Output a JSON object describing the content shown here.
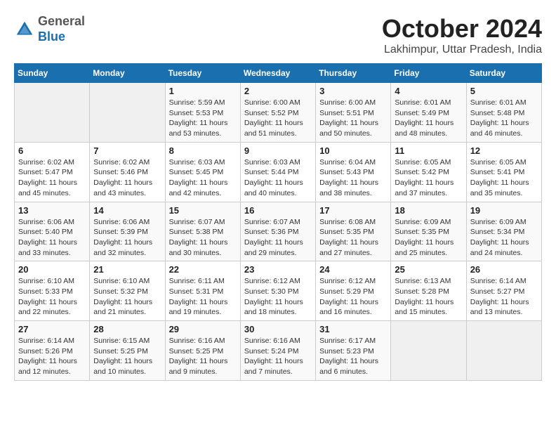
{
  "header": {
    "logo": {
      "line1": "General",
      "line2": "Blue"
    },
    "title": "October 2024",
    "location": "Lakhimpur, Uttar Pradesh, India"
  },
  "days_of_week": [
    "Sunday",
    "Monday",
    "Tuesday",
    "Wednesday",
    "Thursday",
    "Friday",
    "Saturday"
  ],
  "weeks": [
    [
      {
        "day": "",
        "info": ""
      },
      {
        "day": "",
        "info": ""
      },
      {
        "day": "1",
        "info": "Sunrise: 5:59 AM\nSunset: 5:53 PM\nDaylight: 11 hours and 53 minutes."
      },
      {
        "day": "2",
        "info": "Sunrise: 6:00 AM\nSunset: 5:52 PM\nDaylight: 11 hours and 51 minutes."
      },
      {
        "day": "3",
        "info": "Sunrise: 6:00 AM\nSunset: 5:51 PM\nDaylight: 11 hours and 50 minutes."
      },
      {
        "day": "4",
        "info": "Sunrise: 6:01 AM\nSunset: 5:49 PM\nDaylight: 11 hours and 48 minutes."
      },
      {
        "day": "5",
        "info": "Sunrise: 6:01 AM\nSunset: 5:48 PM\nDaylight: 11 hours and 46 minutes."
      }
    ],
    [
      {
        "day": "6",
        "info": "Sunrise: 6:02 AM\nSunset: 5:47 PM\nDaylight: 11 hours and 45 minutes."
      },
      {
        "day": "7",
        "info": "Sunrise: 6:02 AM\nSunset: 5:46 PM\nDaylight: 11 hours and 43 minutes."
      },
      {
        "day": "8",
        "info": "Sunrise: 6:03 AM\nSunset: 5:45 PM\nDaylight: 11 hours and 42 minutes."
      },
      {
        "day": "9",
        "info": "Sunrise: 6:03 AM\nSunset: 5:44 PM\nDaylight: 11 hours and 40 minutes."
      },
      {
        "day": "10",
        "info": "Sunrise: 6:04 AM\nSunset: 5:43 PM\nDaylight: 11 hours and 38 minutes."
      },
      {
        "day": "11",
        "info": "Sunrise: 6:05 AM\nSunset: 5:42 PM\nDaylight: 11 hours and 37 minutes."
      },
      {
        "day": "12",
        "info": "Sunrise: 6:05 AM\nSunset: 5:41 PM\nDaylight: 11 hours and 35 minutes."
      }
    ],
    [
      {
        "day": "13",
        "info": "Sunrise: 6:06 AM\nSunset: 5:40 PM\nDaylight: 11 hours and 33 minutes."
      },
      {
        "day": "14",
        "info": "Sunrise: 6:06 AM\nSunset: 5:39 PM\nDaylight: 11 hours and 32 minutes."
      },
      {
        "day": "15",
        "info": "Sunrise: 6:07 AM\nSunset: 5:38 PM\nDaylight: 11 hours and 30 minutes."
      },
      {
        "day": "16",
        "info": "Sunrise: 6:07 AM\nSunset: 5:36 PM\nDaylight: 11 hours and 29 minutes."
      },
      {
        "day": "17",
        "info": "Sunrise: 6:08 AM\nSunset: 5:35 PM\nDaylight: 11 hours and 27 minutes."
      },
      {
        "day": "18",
        "info": "Sunrise: 6:09 AM\nSunset: 5:35 PM\nDaylight: 11 hours and 25 minutes."
      },
      {
        "day": "19",
        "info": "Sunrise: 6:09 AM\nSunset: 5:34 PM\nDaylight: 11 hours and 24 minutes."
      }
    ],
    [
      {
        "day": "20",
        "info": "Sunrise: 6:10 AM\nSunset: 5:33 PM\nDaylight: 11 hours and 22 minutes."
      },
      {
        "day": "21",
        "info": "Sunrise: 6:10 AM\nSunset: 5:32 PM\nDaylight: 11 hours and 21 minutes."
      },
      {
        "day": "22",
        "info": "Sunrise: 6:11 AM\nSunset: 5:31 PM\nDaylight: 11 hours and 19 minutes."
      },
      {
        "day": "23",
        "info": "Sunrise: 6:12 AM\nSunset: 5:30 PM\nDaylight: 11 hours and 18 minutes."
      },
      {
        "day": "24",
        "info": "Sunrise: 6:12 AM\nSunset: 5:29 PM\nDaylight: 11 hours and 16 minutes."
      },
      {
        "day": "25",
        "info": "Sunrise: 6:13 AM\nSunset: 5:28 PM\nDaylight: 11 hours and 15 minutes."
      },
      {
        "day": "26",
        "info": "Sunrise: 6:14 AM\nSunset: 5:27 PM\nDaylight: 11 hours and 13 minutes."
      }
    ],
    [
      {
        "day": "27",
        "info": "Sunrise: 6:14 AM\nSunset: 5:26 PM\nDaylight: 11 hours and 12 minutes."
      },
      {
        "day": "28",
        "info": "Sunrise: 6:15 AM\nSunset: 5:25 PM\nDaylight: 11 hours and 10 minutes."
      },
      {
        "day": "29",
        "info": "Sunrise: 6:16 AM\nSunset: 5:25 PM\nDaylight: 11 hours and 9 minutes."
      },
      {
        "day": "30",
        "info": "Sunrise: 6:16 AM\nSunset: 5:24 PM\nDaylight: 11 hours and 7 minutes."
      },
      {
        "day": "31",
        "info": "Sunrise: 6:17 AM\nSunset: 5:23 PM\nDaylight: 11 hours and 6 minutes."
      },
      {
        "day": "",
        "info": ""
      },
      {
        "day": "",
        "info": ""
      }
    ]
  ]
}
